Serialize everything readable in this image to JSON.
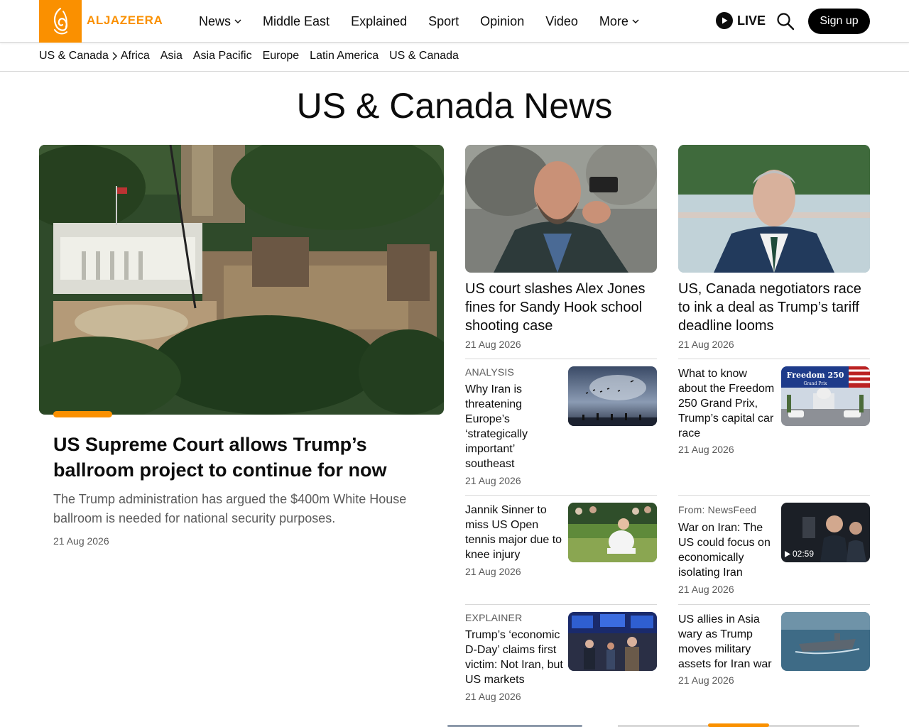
{
  "brand": {
    "name": "ALJAZEERA",
    "accent": "#fa9000"
  },
  "nav": {
    "items": [
      {
        "label": "News",
        "dropdown": true
      },
      {
        "label": "Middle East",
        "dropdown": false
      },
      {
        "label": "Explained",
        "dropdown": false
      },
      {
        "label": "Sport",
        "dropdown": false
      },
      {
        "label": "Opinion",
        "dropdown": false
      },
      {
        "label": "Video",
        "dropdown": false
      },
      {
        "label": "More",
        "dropdown": true
      }
    ],
    "live_label": "LIVE",
    "signup_label": "Sign up"
  },
  "subnav": {
    "current": "US & Canada",
    "items": [
      "Africa",
      "Asia",
      "Asia Pacific",
      "Europe",
      "Latin America",
      "US & Canada"
    ]
  },
  "page_title": "US & Canada News",
  "hero": {
    "title": "US Supreme Court allows Trump’s ballroom project to continue for now",
    "description": "The Trump administration has argued the $400m White House ballroom is needed for national security purposes.",
    "date": "21 Aug 2026"
  },
  "cards": [
    {
      "title": "US court slashes Alex Jones fines for Sandy Hook school shooting case",
      "date": "21 Aug 2026"
    },
    {
      "title": "US, Canada negotiators race to ink a deal as Trump’s tariff deadline looms",
      "date": "21 Aug 2026"
    }
  ],
  "list_left": [
    {
      "kicker": "ANALYSIS",
      "title": "Why Iran is threatening Europe’s ‘strategically important’ southeast",
      "date": "21 Aug 2026"
    },
    {
      "kicker": "",
      "title": "Jannik Sinner to miss US Open tennis major due to knee injury",
      "date": "21 Aug 2026"
    },
    {
      "kicker": "EXPLAINER",
      "title": "Trump’s ‘economic D-Day’ claims first victim: Not Iran, but US markets",
      "date": "21 Aug 2026"
    }
  ],
  "list_right": [
    {
      "kicker": "",
      "title": "What to know about the Freedom 250 Grand Prix, Trump’s capital car race",
      "date": "21 Aug 2026",
      "image_text": "Freedom 250",
      "image_subtext": "Grand Prix"
    },
    {
      "kicker": "From: NewsFeed",
      "title": "War on Iran: The US could focus on economically isolating Iran",
      "date": "21 Aug 2026",
      "duration": "02:59"
    },
    {
      "kicker": "",
      "title": "US allies in Asia wary as Trump moves military assets for Iran war",
      "date": "21 Aug 2026"
    }
  ]
}
